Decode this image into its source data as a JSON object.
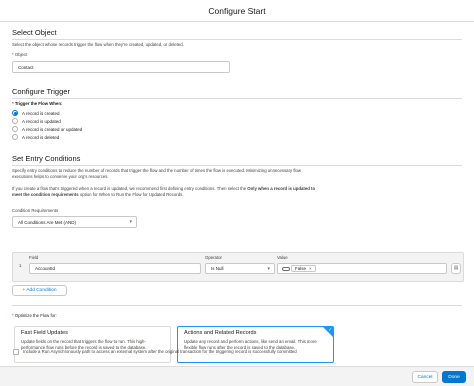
{
  "window": {
    "title": "Configure Start"
  },
  "select_object": {
    "heading": "Select Object",
    "description": "Select the object whose records trigger the flow when they're created, updated, or deleted.",
    "object_label": "Object",
    "object_value": "Contact"
  },
  "trigger": {
    "heading": "Configure Trigger",
    "label": "Trigger the Flow When:",
    "options": [
      "A record is created",
      "A record is updated",
      "A record is created or updated",
      "A record is deleted"
    ],
    "selected": "A record is created"
  },
  "entry": {
    "heading": "Set Entry Conditions",
    "desc1": "Specify entry conditions to reduce the number of records that trigger the flow and the number of times the flow is executed. Minimizing unnecessary flow",
    "desc2": "executions helps to conserve your org's resources.",
    "desc3_pre": "If you create a flow that's triggered when a record is updated, we recommend first defining entry conditions. Then select the ",
    "desc3_bold": "Only when a record is updated to",
    "desc4_bold": "meet the condition requirements",
    "desc4_post": " option for When to Run the Flow for Updated Records.",
    "requirements_label": "Condition Requirements",
    "requirements_value": "All Conditions Are Met (AND)",
    "row_number": "1",
    "field_label": "Field",
    "field_value": "AccountId",
    "operator_label": "Operator",
    "operator_value": "Is Null",
    "value_label": "Value",
    "value_pill": "False",
    "add_condition": "+ Add Condition"
  },
  "optimize": {
    "label": "Optimize the Flow for:",
    "fast": {
      "title": "Fast Field Updates",
      "desc": "Update fields on the record that triggers the flow to run. This high-performance flow runs before the record is saved to the database."
    },
    "actions": {
      "title": "Actions and Related Records",
      "desc": "Update any record and perform actions, like send an email. This more flexible flow runs after the record is saved to the database."
    },
    "async_label": "Include a Run Asynchronously path to access an external system after the original transaction for the triggering record is successfully committed"
  },
  "footer": {
    "cancel": "Cancel",
    "done": "Done"
  },
  "colors": {
    "accent": "#0176d3",
    "selected_border": "#1b96ff",
    "required": "#c23934"
  }
}
